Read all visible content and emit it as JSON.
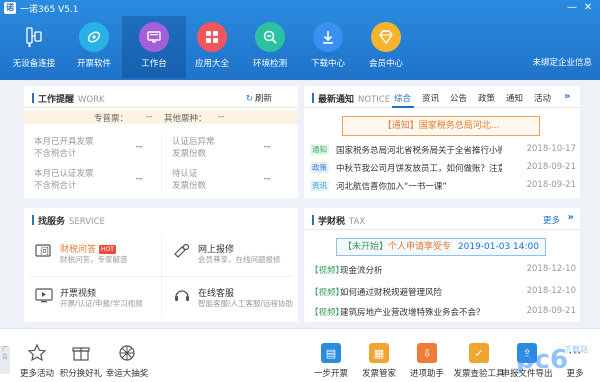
{
  "app": {
    "title": "一诺365 V5.1",
    "logo_text": "诺"
  },
  "window": {
    "minimize": "—",
    "close": "✕"
  },
  "nav": [
    {
      "label": "无设备连接",
      "icon": "usb-device-icon"
    },
    {
      "label": "开票软件",
      "icon": "invoice-software-icon"
    },
    {
      "label": "工作台",
      "icon": "workbench-icon"
    },
    {
      "label": "应用大全",
      "icon": "apps-grid-icon"
    },
    {
      "label": "环境检测",
      "icon": "env-check-icon"
    },
    {
      "label": "下载中心",
      "icon": "download-icon"
    },
    {
      "label": "会员中心",
      "icon": "member-icon"
    }
  ],
  "unbound": "未绑定企业信息",
  "work": {
    "title": "工作提醒",
    "subtitle": "WORK",
    "refresh": "刷新",
    "special_ticket": "专普票：",
    "special_ticket_val": "--",
    "other_ticket": "其他票种：",
    "other_ticket_val": "--",
    "stats": [
      {
        "l1": "本月已开具发票",
        "l2": "不含税合计",
        "val": "--"
      },
      {
        "l1": "认证后异常",
        "l2": "发票份数",
        "val": "--"
      },
      {
        "l1": "本月已认证发票",
        "l2": "不含税合计",
        "val": "--"
      },
      {
        "l1": "待认证",
        "l2": "发票份数",
        "val": "--"
      }
    ]
  },
  "notice": {
    "title": "最新通知",
    "subtitle": "NOTICE",
    "tabs": [
      "综合",
      "资讯",
      "公告",
      "政策",
      "通知",
      "活动"
    ],
    "banner": "【通知】国家税务总局河北...",
    "items": [
      {
        "tag": "通知",
        "text": "国家税务总局河北省税务局关于全省推行小微...",
        "date": "2018-10-17"
      },
      {
        "tag": "政策",
        "text": "中秋节我公司月饼发放员工，如何做账？注意...",
        "date": "2018-09-21"
      },
      {
        "tag": "资讯",
        "text": "河北航信喜你加入“一书一课”",
        "date": "2018-09-21"
      }
    ]
  },
  "service": {
    "title": "找服务",
    "subtitle": "SERVICE",
    "items": [
      {
        "title": "财税问答",
        "hot": "HOT",
        "sub": "财税问答，专家解惑"
      },
      {
        "title": "网上报修",
        "sub": "会员尊享，在线问题报修"
      },
      {
        "title": "开票视频",
        "sub": "开票/认证/申报/学习视频"
      },
      {
        "title": "在线客服",
        "sub": "智能客服/人工客服/远程协助"
      }
    ]
  },
  "tax": {
    "title": "学财税",
    "subtitle": "TAX",
    "more": "更多",
    "banner_status": "【未开始】",
    "banner_text": "个人申请享受专",
    "banner_date": "2019-01-03 14:00",
    "items": [
      {
        "tag": "【视频】",
        "text": "现金流分析",
        "date": "2018-12-10"
      },
      {
        "tag": "【视频】",
        "text": "如何通过财税规避管理风险",
        "date": "2018-12-10"
      },
      {
        "tag": "【视频】",
        "text": "建筑房地产业营改增特殊业务会不会？",
        "date": "2018-09-21"
      }
    ]
  },
  "bottom_left": [
    {
      "label": "更多活动",
      "icon": "star-icon"
    },
    {
      "label": "积分换好礼",
      "icon": "gift-icon"
    },
    {
      "label": "幸运大抽奖",
      "icon": "wheel-icon"
    }
  ],
  "bottom_right": [
    {
      "label": "一步开票",
      "icon": "one-step-icon",
      "color": "#2a8be0"
    },
    {
      "label": "发票管家",
      "icon": "invoice-manager-icon",
      "color": "#f0a530"
    },
    {
      "label": "进项助手",
      "icon": "input-assistant-icon",
      "color": "#f07a3a"
    },
    {
      "label": "发票查验工具",
      "icon": "invoice-verify-icon",
      "color": "#f0a530"
    },
    {
      "label": "申报文件导出",
      "icon": "report-export-icon",
      "color": "#2a8be0"
    },
    {
      "label": "更多",
      "icon": "more-icon",
      "color": "#888888"
    }
  ],
  "side_tab": "广告",
  "watermark": "pc6",
  "watermark_sub": "下载站",
  "colors": {
    "primary": "#1f73c9",
    "accent": "#e8792e"
  }
}
